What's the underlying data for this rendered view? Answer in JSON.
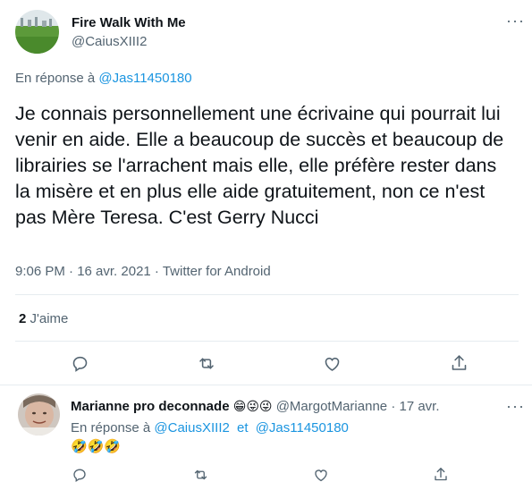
{
  "main_tweet": {
    "author_name": "Fire Walk With Me",
    "author_handle": "@CaiusXIII2",
    "reply_prefix": "En réponse à",
    "reply_to": "@Jas11450180",
    "text": "Je connais personnellement une écrivaine qui pourrait lui venir en aide. Elle a beaucoup de succès et beaucoup de librairies se l'arrachent mais elle, elle préfère rester dans la misère et en plus elle aide gratuitement, non ce n'est pas Mère Teresa. C'est Gerry Nucci",
    "meta": "9:06 PM · 16 avr. 2021 · Twitter for Android",
    "likes_count": "2",
    "likes_label": "J'aime"
  },
  "reply_tweet": {
    "author_name": "Marianne pro deconnade",
    "author_emojis": "😁😜😜",
    "author_handle": "@MargotMarianne",
    "separator": "·",
    "date": "17 avr.",
    "reply_prefix": "En réponse à",
    "reply_to_1": "@CaiusXIII2",
    "reply_and": "et",
    "reply_to_2": "@Jas11450180",
    "text": "🤣🤣🤣"
  },
  "actions": [
    "reply-icon",
    "retweet-icon",
    "like-icon",
    "share-icon"
  ],
  "colors": {
    "link": "#1b95e0",
    "muted": "#536471",
    "divider": "#e6ecf0",
    "text": "#0f1419"
  }
}
